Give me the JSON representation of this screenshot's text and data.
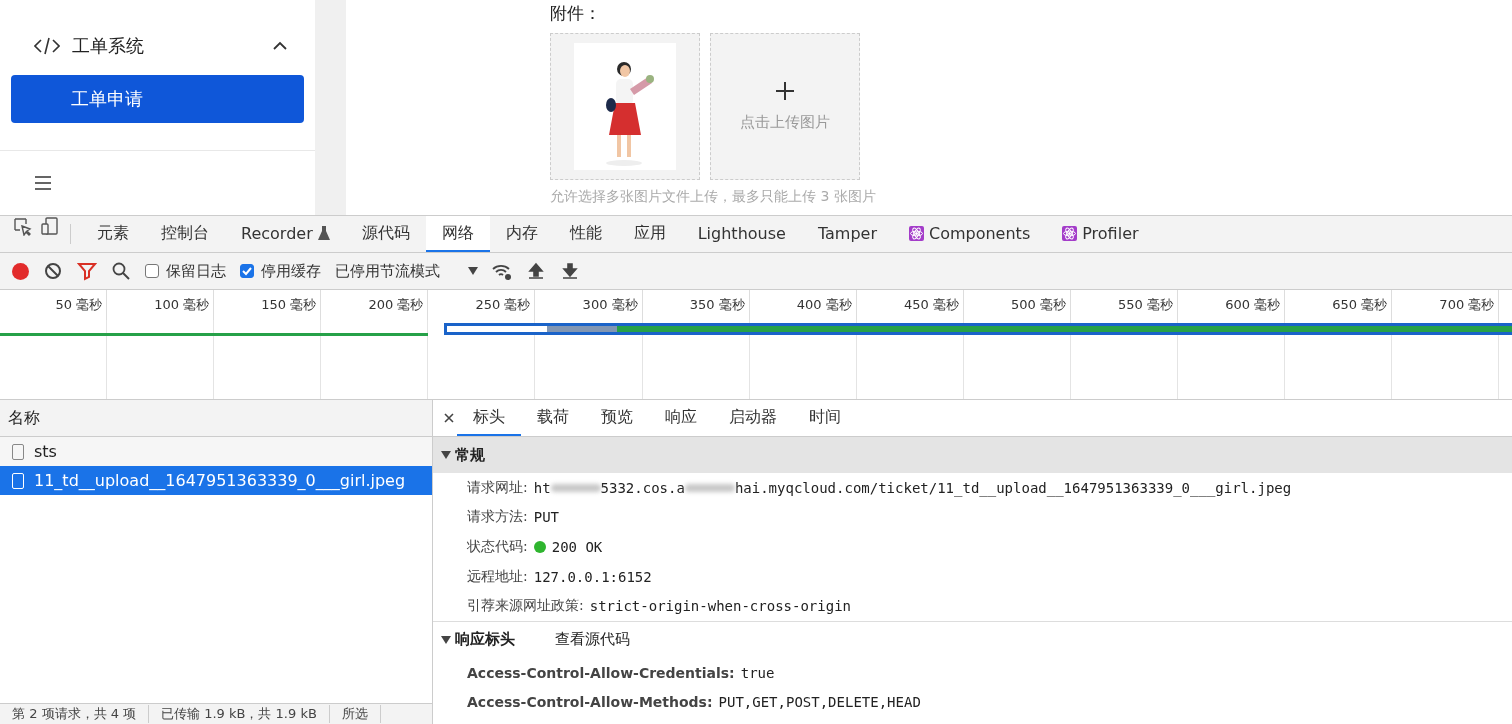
{
  "sidebar": {
    "group": {
      "label": "工单系统",
      "expanded": true
    },
    "items": [
      {
        "label": "工单申请",
        "selected": true
      }
    ]
  },
  "form": {
    "attachments_label": "附件：",
    "upload_label": "点击上传图片",
    "hint": "允许选择多张图片文件上传，最多只能上传 3 张图片"
  },
  "devtools": {
    "tabs": [
      {
        "label": "元素",
        "selected": false
      },
      {
        "label": "控制台",
        "selected": false
      },
      {
        "label": "Recorder",
        "selected": false,
        "kind": "flask"
      },
      {
        "label": "源代码",
        "selected": false
      },
      {
        "label": "网络",
        "selected": true
      },
      {
        "label": "内存",
        "selected": false
      },
      {
        "label": "性能",
        "selected": false
      },
      {
        "label": "应用",
        "selected": false
      },
      {
        "label": "Lighthouse",
        "selected": false
      },
      {
        "label": "Tamper",
        "selected": false
      },
      {
        "label": "Components",
        "selected": false,
        "kind": "react"
      },
      {
        "label": "Profiler",
        "selected": false,
        "kind": "react"
      }
    ],
    "toolbar": {
      "recording": true,
      "preserve_log": {
        "label": "保留日志",
        "checked": false
      },
      "disable_cache": {
        "label": "停用缓存",
        "checked": true
      },
      "throttling": "已停用节流模式"
    },
    "timeline_ticks": [
      "50 毫秒",
      "100 毫秒",
      "150 毫秒",
      "200 毫秒",
      "250 毫秒",
      "300 毫秒",
      "350 毫秒",
      "400 毫秒",
      "450 毫秒",
      "500 毫秒",
      "550 毫秒",
      "600 毫秒",
      "650 毫秒",
      "700 毫秒"
    ],
    "requests": {
      "column": "名称",
      "rows": [
        {
          "name": "sts",
          "selected": false
        },
        {
          "name": "11_td__upload__1647951363339_0___girl.jpeg",
          "selected": true
        }
      ]
    },
    "status_bar": [
      "第 2 项请求，共 4 项",
      "已传输 1.9 kB，共 1.9 kB",
      "所选"
    ],
    "detail_tabs": [
      {
        "label": "标头",
        "selected": true
      },
      {
        "label": "载荷",
        "selected": false
      },
      {
        "label": "预览",
        "selected": false
      },
      {
        "label": "响应",
        "selected": false
      },
      {
        "label": "启动器",
        "selected": false
      },
      {
        "label": "时间",
        "selected": false
      }
    ],
    "general": {
      "title": "常规",
      "expanded": true,
      "url_label": "请求网址:",
      "url_parts": [
        "ht",
        "5332.cos.a",
        "hai.myqcloud.com/ticket/11_td__upload__1647951363339_0___girl.jpeg"
      ],
      "rows": [
        {
          "label": "请求方法:",
          "value": "PUT"
        },
        {
          "label": "状态代码:",
          "value": "200 OK",
          "kind": "status",
          "color": "#2fb52f"
        },
        {
          "label": "远程地址:",
          "value": "127.0.0.1:6152"
        },
        {
          "label": "引荐来源网址政策:",
          "value": "strict-origin-when-cross-origin"
        }
      ]
    },
    "response_headers": {
      "title": "响应标头",
      "expanded": true,
      "view_source": "查看源代码",
      "rows": [
        {
          "label": "Access-Control-Allow-Credentials:",
          "value": "true"
        },
        {
          "label": "Access-Control-Allow-Methods:",
          "value": "PUT,GET,POST,DELETE,HEAD"
        }
      ]
    }
  }
}
